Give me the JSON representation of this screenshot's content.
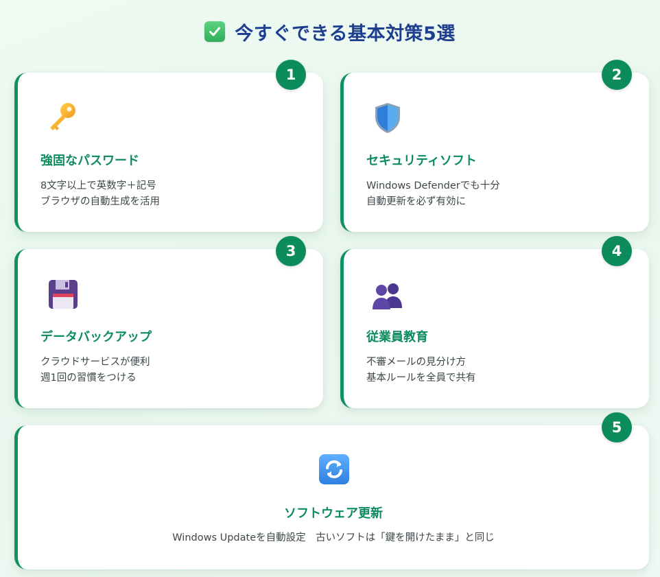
{
  "header": {
    "title": "今すぐできる基本対策5選",
    "icon": "check-mark-button-icon"
  },
  "colors": {
    "accent": "#0c8c5c",
    "title": "#1e3f8f",
    "card_border": "#10915f"
  },
  "cards": [
    {
      "number": "1",
      "icon": "key-icon",
      "title": "強固なパスワード",
      "lines": [
        "8文字以上で英数字＋記号",
        "ブラウザの自動生成を活用"
      ]
    },
    {
      "number": "2",
      "icon": "shield-icon",
      "title": "セキュリティソフト",
      "lines": [
        "Windows Defenderでも十分",
        "自動更新を必ず有効に"
      ]
    },
    {
      "number": "3",
      "icon": "floppy-disk-icon",
      "title": "データバックアップ",
      "lines": [
        "クラウドサービスが便利",
        "週1回の習慣をつける"
      ]
    },
    {
      "number": "4",
      "icon": "people-icon",
      "title": "従業員教育",
      "lines": [
        "不審メールの見分け方",
        "基本ルールを全員で共有"
      ]
    },
    {
      "number": "5",
      "icon": "update-arrows-icon",
      "title": "ソフトウェア更新",
      "lines": [
        "Windows Updateを自動設定　古いソフトは「鍵を開けたまま」と同じ"
      ]
    }
  ]
}
